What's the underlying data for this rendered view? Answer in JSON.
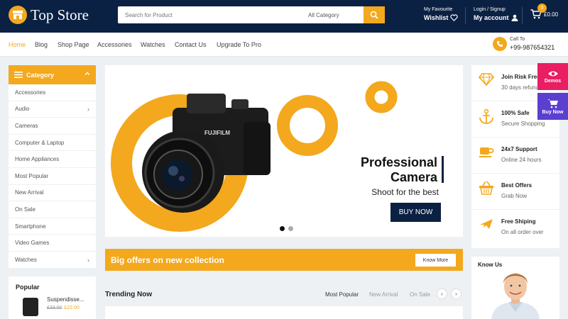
{
  "header": {
    "logo_text": "Top Store",
    "search_placeholder": "Search for Product",
    "category_select": "All Category",
    "favourite_small": "My Favourite",
    "favourite_big": "Wishlist",
    "account_small": "Login / Signup",
    "account_big": "My account",
    "cart_count": "0",
    "cart_total": "£0.00"
  },
  "nav": {
    "items": [
      "Home",
      "Blog",
      "Shop Page",
      "Accessories",
      "Watches",
      "Contact Us",
      "Upgrade To Pro"
    ],
    "call_label": "Call To",
    "call_number": "+99-987654321"
  },
  "sidebar": {
    "category_title": "Category",
    "categories": [
      "Accessories",
      "Audio",
      "Cameras",
      "Computer & Laptop",
      "Home Appliances",
      "Most Popular",
      "New Arrival",
      "On Sale",
      "Smartphone",
      "Video Games",
      "Watches"
    ],
    "popular_title": "Popular",
    "popular_item": {
      "name": "Suspendisse...",
      "old_price": "£33.00",
      "new_price": "£22.00"
    }
  },
  "hero": {
    "title_line1": "Professional",
    "title_line2": "Camera",
    "subtitle": "Shoot for the best",
    "button": "BUY NOW",
    "camera_brand": "FUJIFILM"
  },
  "banner": {
    "text": "Big offers on new collection",
    "button": "Know More"
  },
  "trending": {
    "title": "Trending Now",
    "tabs": [
      "Most Popular",
      "New Arrival",
      "On Sale"
    ]
  },
  "features": [
    {
      "title": "Join Risk Free",
      "sub": "30 days refund",
      "icon": "diamond-icon"
    },
    {
      "title": "100% Safe",
      "sub": "Secure Shopping",
      "icon": "anchor-icon"
    },
    {
      "title": "24x7 Support",
      "sub": "Online 24 hours",
      "icon": "coffee-cup-icon"
    },
    {
      "title": "Best Offers",
      "sub": "Grab Now",
      "icon": "basket-icon"
    },
    {
      "title": "Free Shiping",
      "sub": "On all order over",
      "icon": "plane-icon"
    }
  ],
  "knowus": {
    "title": "Know Us"
  },
  "floating": {
    "demos": "Demos",
    "buy_now": "Buy Now"
  },
  "colors": {
    "accent": "#f3a81d",
    "navy": "#0b2143",
    "pink": "#e91e63",
    "purple": "#5b3fd0"
  }
}
